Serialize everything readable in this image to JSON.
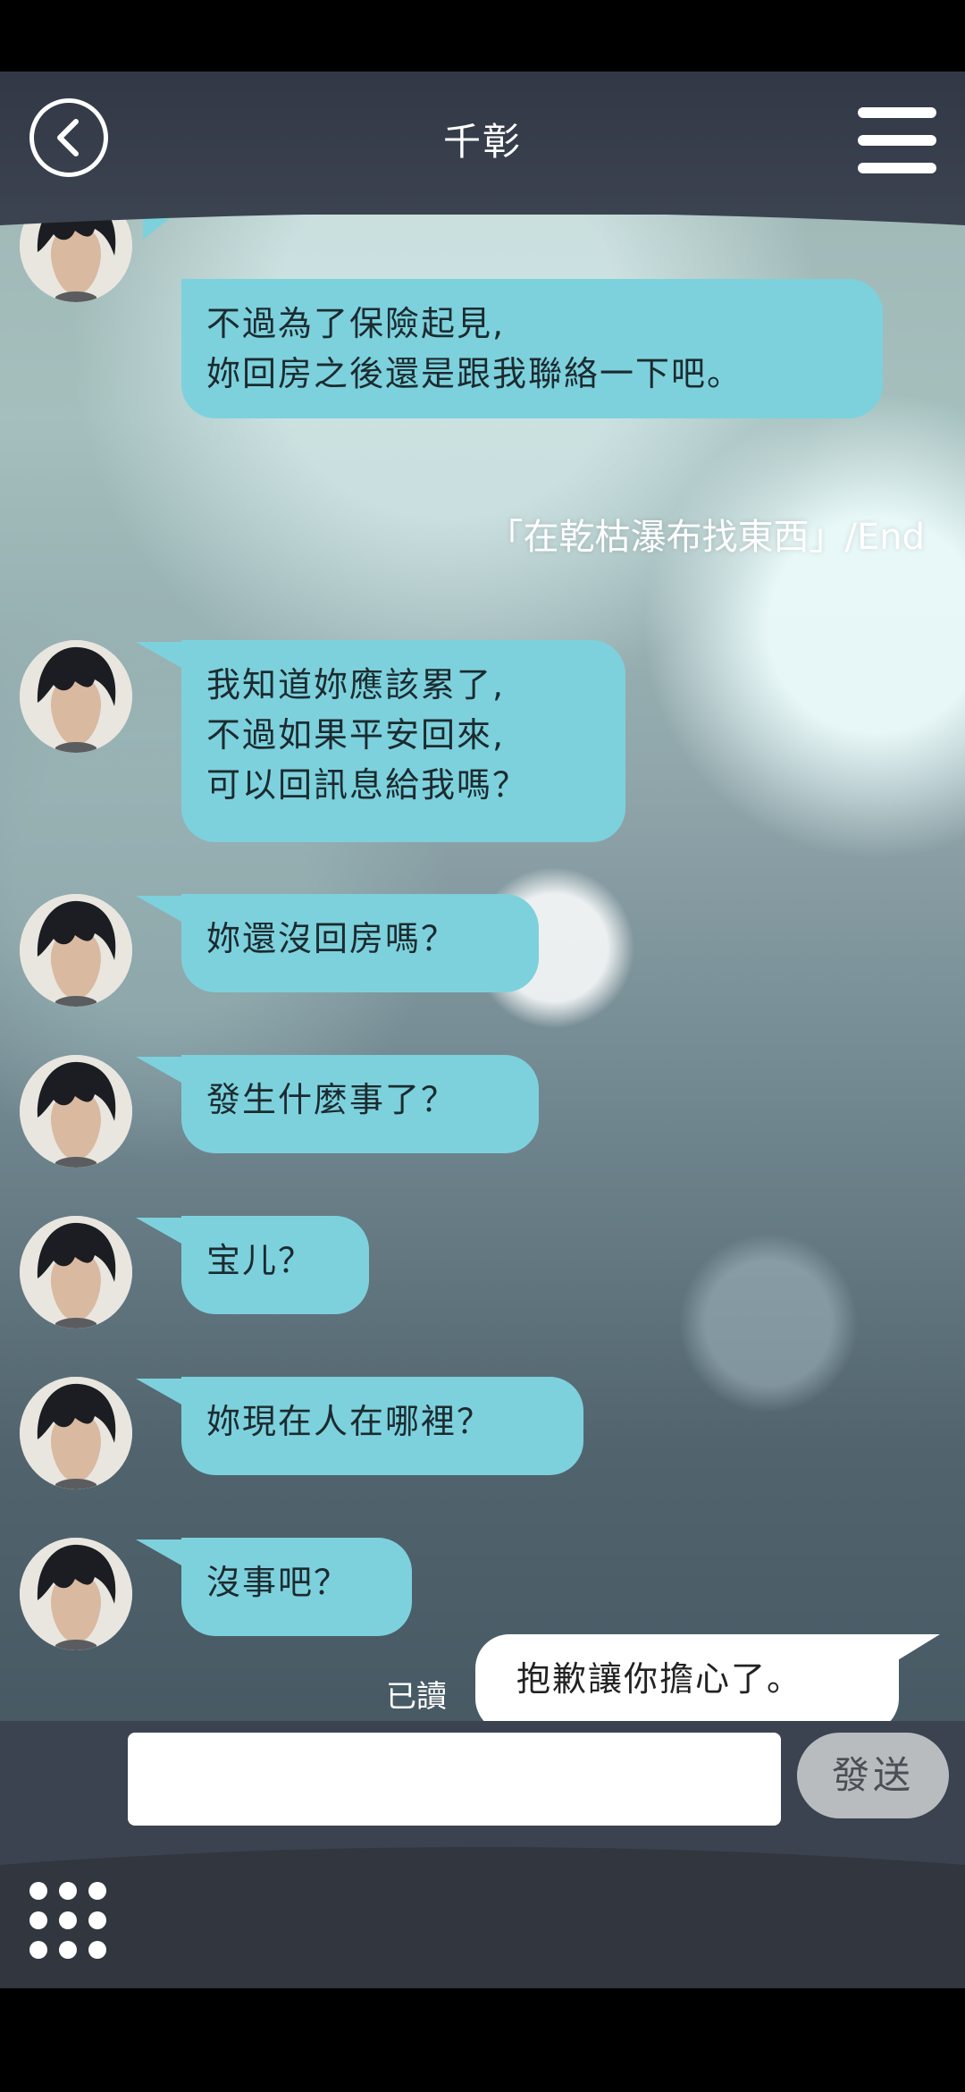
{
  "header": {
    "title": "千彰"
  },
  "messages": [
    {
      "text": "不過為了保險起見,\n妳回房之後還是跟我聯絡一下吧。"
    },
    {
      "text": "我知道妳應該累了,\n不過如果平安回來,\n可以回訊息給我嗎？"
    },
    {
      "text": "妳還沒回房嗎？"
    },
    {
      "text": "發生什麼事了？"
    },
    {
      "text": "宝儿？"
    },
    {
      "text": "妳現在人在哪裡？"
    },
    {
      "text": "沒事吧？"
    }
  ],
  "system_note": "「在乾枯瀑布找東西」/End",
  "outgoing": {
    "read_label": "已讀",
    "text": "抱歉讓你擔心了。"
  },
  "composer": {
    "placeholder": "",
    "send_label": "發送"
  },
  "colors": {
    "incoming_bubble": "#7dd1dd",
    "outgoing_bubble": "#ffffff",
    "header_bg": "#3b4250"
  }
}
